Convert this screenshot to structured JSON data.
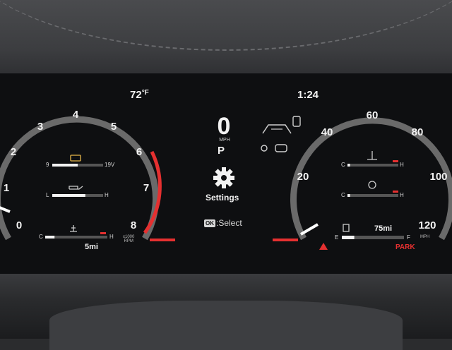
{
  "header": {
    "outside_temp_value": "72",
    "outside_temp_unit": "°F",
    "clock": "1:24"
  },
  "center": {
    "speed": "0",
    "speed_unit": "MPH",
    "gear": "P",
    "menu_label": "Settings",
    "select_hint_key": "OK",
    "select_hint_text": ":Select"
  },
  "tachometer": {
    "ticks": [
      "0",
      "1",
      "2",
      "3",
      "4",
      "5",
      "6",
      "7",
      "8"
    ],
    "unit_line1": "x1000",
    "unit_line2": "RPM",
    "redline_start": "6"
  },
  "speedometer": {
    "ticks": [
      "0",
      "20",
      "40",
      "60",
      "80",
      "100",
      "120"
    ],
    "unit": "MPH"
  },
  "left_gauges": {
    "battery": {
      "low": "9",
      "high": "19V",
      "level": 0.5
    },
    "oil_pressure": {
      "low": "L",
      "high": "H",
      "level": 0.65
    },
    "coolant_temp": {
      "low": "C",
      "high": "H",
      "level": 0.15
    },
    "trip_distance": "5mi"
  },
  "right_gauges": {
    "oil_temp": {
      "low": "C",
      "high": "H",
      "level": 0.05
    },
    "trans_temp": {
      "low": "C",
      "high": "H",
      "level": 0.05
    },
    "fuel": {
      "low": "E",
      "high": "F",
      "level": 0.2
    },
    "range": "75mi",
    "park_indicator": "PARK"
  },
  "colors": {
    "accent_red": "#e53030",
    "gauge_white": "#f2f2f2",
    "track_gray": "#555555"
  },
  "icons": [
    "gear-icon",
    "lane-departure-icon",
    "driver-assist-icon",
    "seatbelt-icon",
    "battery-icon",
    "oil-can-icon",
    "coolant-icon",
    "fuel-pump-icon",
    "parking-brake-icon"
  ]
}
